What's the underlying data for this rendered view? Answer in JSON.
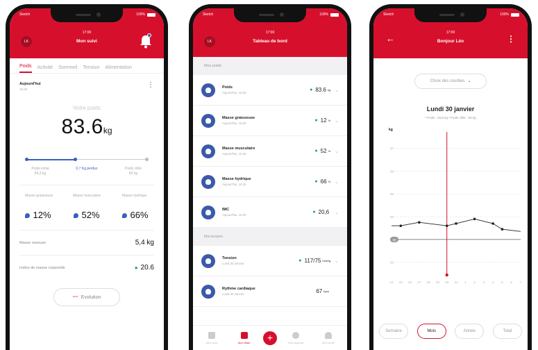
{
  "status": {
    "carrier": "Sketch",
    "battery": "100%"
  },
  "p1": {
    "time": "17:00",
    "title": "Mon suivi",
    "avatar": "LK",
    "tabs": [
      "Poids",
      "Activité",
      "Sommeil",
      "Tension",
      "Alimentation"
    ],
    "today_label": "Aujourd'hui",
    "today_time": "16:30",
    "weight_label": "Votre poids",
    "weight_value": "83.6",
    "weight_unit": "kg",
    "progress_fraction": 0.4,
    "initial_label": "Poids initial",
    "initial_value": "84,3 kg",
    "lost_label": "0,7 Kg perdus",
    "target_label": "Poids cible",
    "target_value": "83 kg",
    "comp_labels": [
      "Masse graisseuse",
      "Masse musculaire",
      "Masse hydrique"
    ],
    "comp_values": [
      "12%",
      "52%",
      "66%"
    ],
    "bone_label": "Masse osseuse",
    "bone_value": "5,4 kg",
    "bmi_label": "Indice de masse corporelle",
    "bmi_value": "20.6",
    "evo_label": "Evolution"
  },
  "p2": {
    "time": "17:00",
    "title": "Tableau de bord",
    "avatar": "LK",
    "sec1": "Mes poids",
    "rows": [
      {
        "name": "Poids",
        "sub": "Aujourd'hui, 16:30",
        "val": "83.6",
        "unit": "kg"
      },
      {
        "name": "Masse graisseuse",
        "sub": "Aujourd'hui, 16:30",
        "val": "12",
        "unit": "%"
      },
      {
        "name": "Masse musculaire",
        "sub": "Aujourd'hui, 16:30",
        "val": "52",
        "unit": "%"
      },
      {
        "name": "Masse hydrique",
        "sub": "Aujourd'hui, 16:30",
        "val": "66",
        "unit": "%"
      },
      {
        "name": "IMC",
        "sub": "Aujourd'hui, 16:30",
        "val": "20,6",
        "unit": ""
      }
    ],
    "sec2": "Ma tension",
    "rows2": [
      {
        "name": "Tension",
        "sub": "Lundi 30 Janvier",
        "val": "117/75",
        "unit": "mmHg"
      },
      {
        "name": "Rythme cardiaque",
        "sub": "Lundi 30 Janvier",
        "val": "67",
        "unit": "bpm"
      }
    ],
    "nav": [
      "Mon suivi",
      "Mon bilan",
      "",
      "Mon agenda",
      "Mon profil"
    ]
  },
  "p3": {
    "time": "17:00",
    "title": "Bonjour Léo",
    "curves_label": "Choix des courbes",
    "chart_title": "Lundi 30 janvier",
    "chart_sub": "• Poids : 83,6 kg  • Poids cible : 83 kg",
    "periods": [
      "Semaine",
      "Mois",
      "Année",
      "Total"
    ],
    "active_period": "Mois"
  },
  "chart_data": {
    "type": "line",
    "title": "Lundi 30 janvier",
    "ylabel": "kg",
    "yticks": [
      82,
      83,
      84,
      85,
      86,
      87
    ],
    "ylim": [
      81.5,
      87.6
    ],
    "x": [
      "24",
      "25",
      "26",
      "27",
      "28",
      "29",
      "30",
      "31",
      "1",
      "2",
      "3",
      "4",
      "5",
      "6",
      "7"
    ],
    "series": [
      {
        "name": "Poids",
        "x": [
          "25",
          "27",
          "30",
          "31",
          "2",
          "4",
          "5"
        ],
        "values": [
          83.6,
          83.75,
          83.6,
          83.7,
          83.9,
          83.7,
          83.45
        ]
      }
    ],
    "target": 83,
    "highlight": "30",
    "legend": "top",
    "grid": true
  }
}
